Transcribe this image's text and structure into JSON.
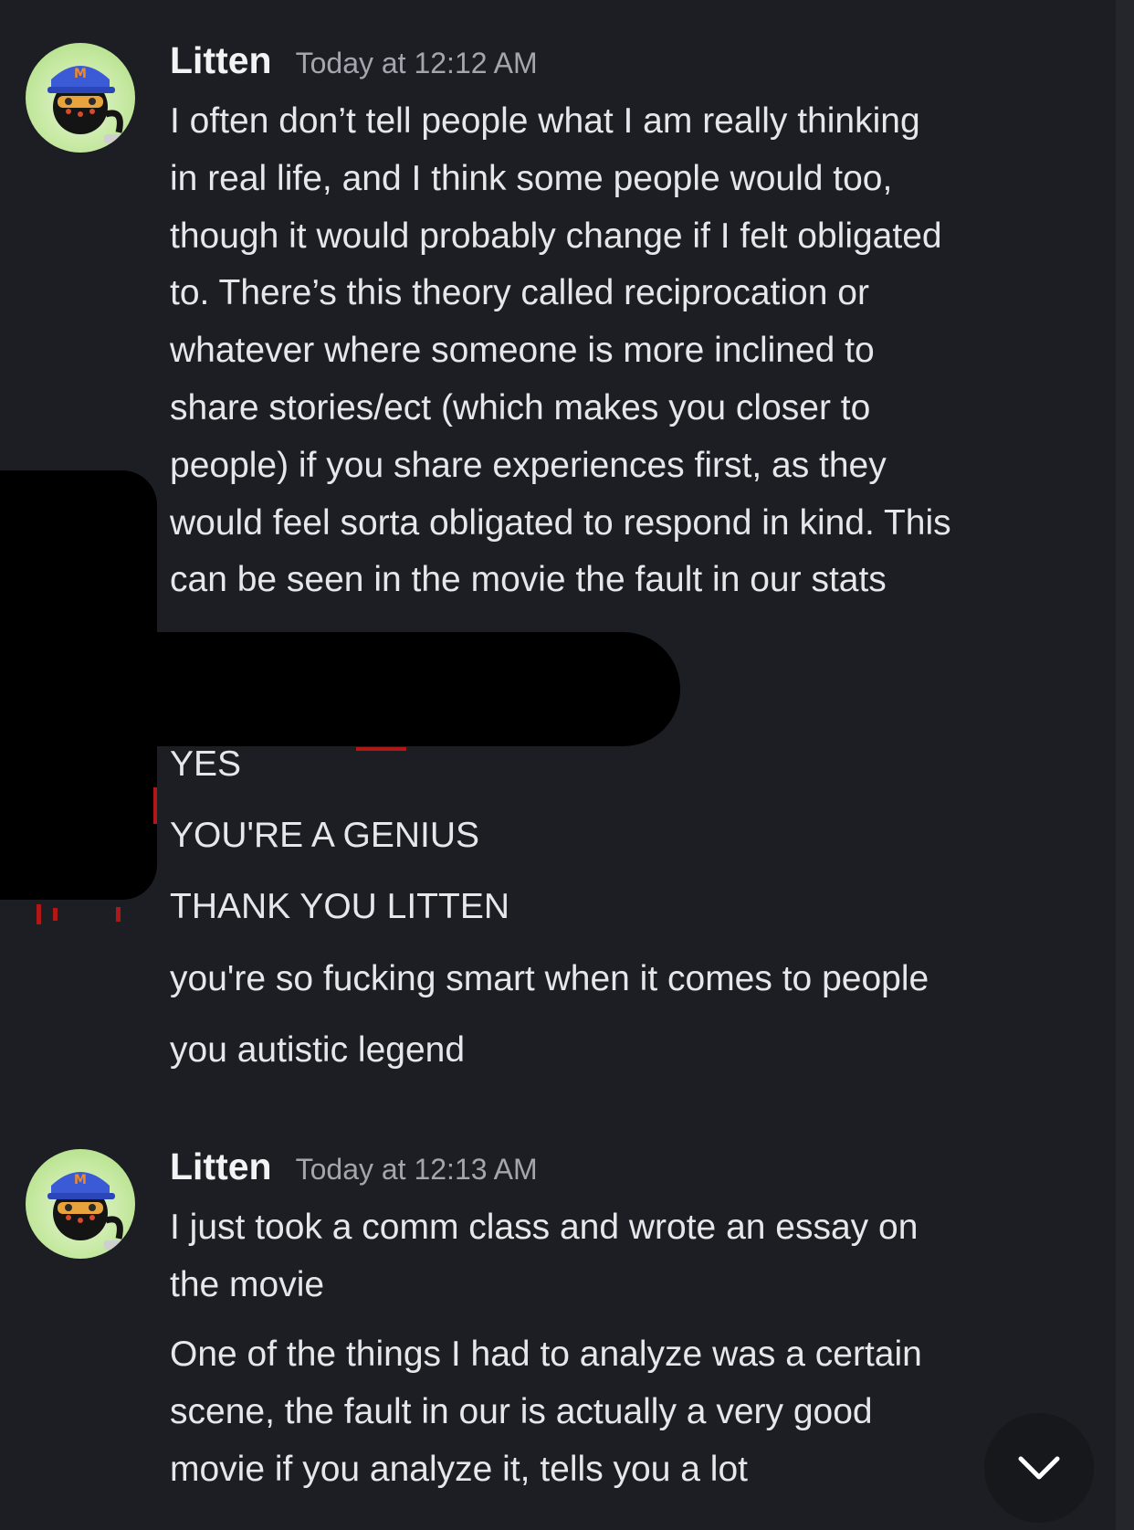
{
  "messages": [
    {
      "username": "Litten",
      "timestamp": "Today at 12:12 AM",
      "lines": [
        "I often don’t tell people what I am really thinking",
        "in real life, and I think some people would too,",
        "though it would probably change if I felt obligated",
        "to. There’s this theory called reciprocation or",
        "whatever where someone is more inclined to",
        "share stories/ect (which makes you closer to",
        "people) if you share experiences first, as they",
        "would feel sorta obligated to respond in kind. This",
        "can be seen in the movie the fault in our stats"
      ]
    },
    {
      "username": "Litten",
      "timestamp": "Today at 12:13 AM",
      "paragraphs": [
        [
          "I just took a comm class and wrote an essay on",
          "the movie"
        ],
        [
          "One of the things I had to analyze was a certain",
          "scene, the fault in our is actually a very good",
          "movie if you analyze it, tells you a lot"
        ]
      ]
    }
  ],
  "reply_messages": [
    "YES",
    "YOU'RE A GENIUS",
    "THANK YOU LITTEN",
    "you're so fucking smart when it comes to people",
    "you autistic legend"
  ],
  "icons": {
    "avatar": "cat-avatar-icon",
    "scroll": "chevron-down-icon"
  },
  "colors": {
    "background": "#1d1e23",
    "username": "#f2f3f5",
    "timestamp": "#a3a6ad",
    "text": "#e6e7ea"
  }
}
